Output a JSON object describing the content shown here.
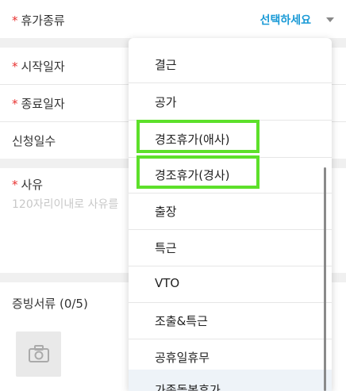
{
  "form": {
    "leave_type": {
      "required_mark": "*",
      "label": "휴가종류",
      "value": "선택하세요"
    },
    "start_date": {
      "required_mark": "*",
      "label": "시작일자"
    },
    "end_date": {
      "required_mark": "*",
      "label": "종료일자"
    },
    "days": {
      "label": "신청일수"
    },
    "reason": {
      "required_mark": "*",
      "label": "사유",
      "placeholder": "120자리이내로 사유를"
    },
    "attachments": {
      "label": "증빙서류 (0/5)"
    }
  },
  "dropdown": {
    "options": [
      "결근",
      "공가",
      "경조휴가(애사)",
      "경조휴가(경사)",
      "출장",
      "특근",
      "VTO",
      "조출&특근",
      "공휴일휴무",
      "가족돌봄휴가"
    ]
  },
  "colors": {
    "accent": "#1a9ad6",
    "required": "#e8312f",
    "highlight": "#5de02a"
  },
  "icons": {
    "caret": "chevron-down-icon",
    "camera": "camera-icon"
  }
}
